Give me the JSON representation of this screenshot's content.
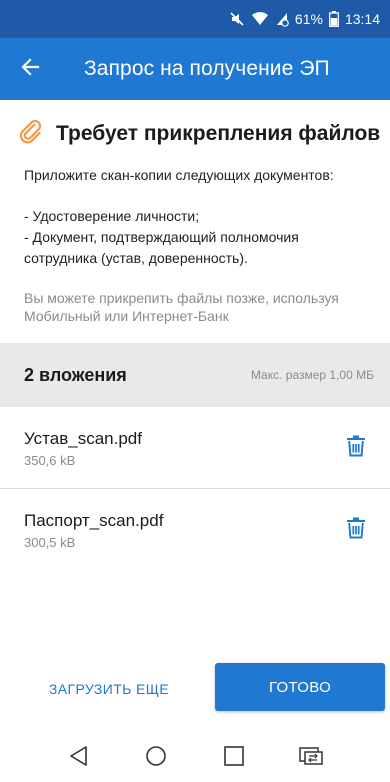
{
  "status_bar": {
    "battery_percent": "61%",
    "time": "13:14",
    "icons": [
      "mute-icon",
      "wifi-icon",
      "battery-saver-icon",
      "battery-icon"
    ]
  },
  "app_bar": {
    "title": "Запрос на получение ЭП",
    "back_icon": "arrow-left-icon"
  },
  "requirement": {
    "icon": "paperclip-icon",
    "title": "Требует прикрепления файлов",
    "intro": "Приложите скан-копии следующих документов:",
    "documents": [
      "- Удостоверение личности;",
      "- Документ, подтверждающий полномочия",
      "сотрудника (устав, доверенность)."
    ],
    "note": "Вы можете прикрепить файлы позже, используя Мобильный или Интернет-Банк"
  },
  "attachments": {
    "count_label": "2 вложения",
    "max_size_label": "Макс. размер 1,00 МБ",
    "files": [
      {
        "name": "Устав_scan.pdf",
        "size": "350,6 kB"
      },
      {
        "name": "Паспорт_scan.pdf",
        "size": "300,5 kB"
      }
    ]
  },
  "actions": {
    "upload_more": "ЗАГРУЗИТЬ ЕЩЕ",
    "done": "ГОТОВО"
  },
  "nav": [
    "back-triangle-icon",
    "home-circle-icon",
    "recents-square-icon",
    "switch-app-icon"
  ],
  "colors": {
    "status_bar": "#1e5aa8",
    "app_bar": "#1f78d1",
    "accent": "#1f78d1",
    "paperclip": "#f2994a"
  }
}
